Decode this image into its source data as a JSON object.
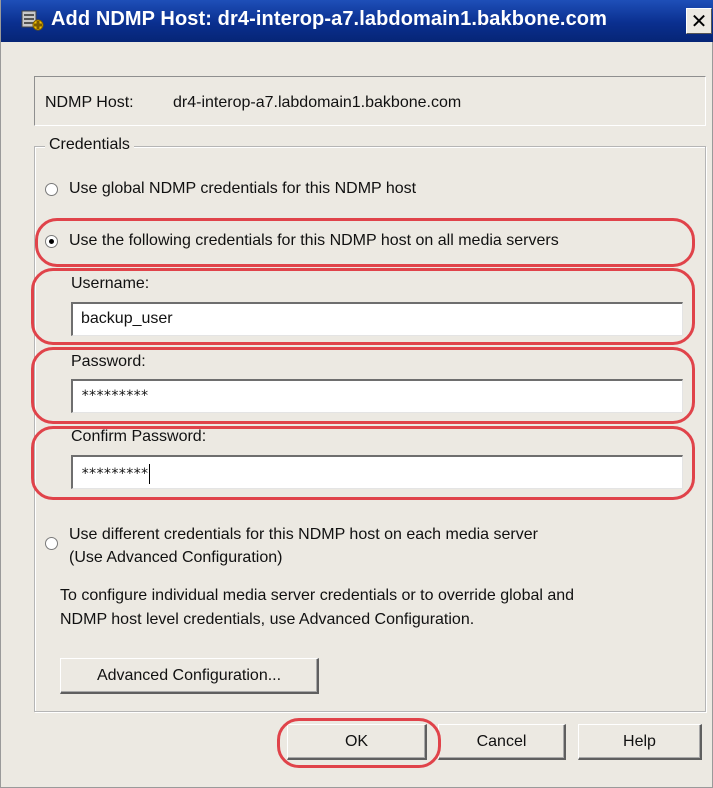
{
  "window": {
    "title": "Add NDMP Host: dr4-interop-a7.labdomain1.bakbone.com",
    "close_glyph": "✕",
    "app_icon": "ndmp-host-icon"
  },
  "host": {
    "label": "NDMP Host:",
    "value": "dr4-interop-a7.labdomain1.bakbone.com"
  },
  "credentials": {
    "group_label": "Credentials",
    "options": [
      {
        "label": "Use global NDMP credentials for this NDMP host",
        "checked": false
      },
      {
        "label": "Use the following credentials for this NDMP host on all media servers",
        "checked": true
      },
      {
        "label": "Use different credentials for this NDMP host on each media server",
        "label_line2": "(Use Advanced Configuration)",
        "checked": false
      }
    ],
    "username": {
      "label": "Username:",
      "value": "backup_user"
    },
    "password": {
      "label": "Password:",
      "value": "*********"
    },
    "confirm_password": {
      "label": "Confirm Password:",
      "value": "*********"
    },
    "info_line1": "To configure individual media server credentials or to override global and",
    "info_line2": "NDMP host level credentials, use Advanced Configuration.",
    "advanced_button": "Advanced Configuration..."
  },
  "buttons": {
    "ok": "OK",
    "cancel": "Cancel",
    "help": "Help"
  },
  "colors": {
    "highlight": "#e0434a",
    "titlebar": "#0a2f8f",
    "dialog_bg": "#ece9e2"
  }
}
